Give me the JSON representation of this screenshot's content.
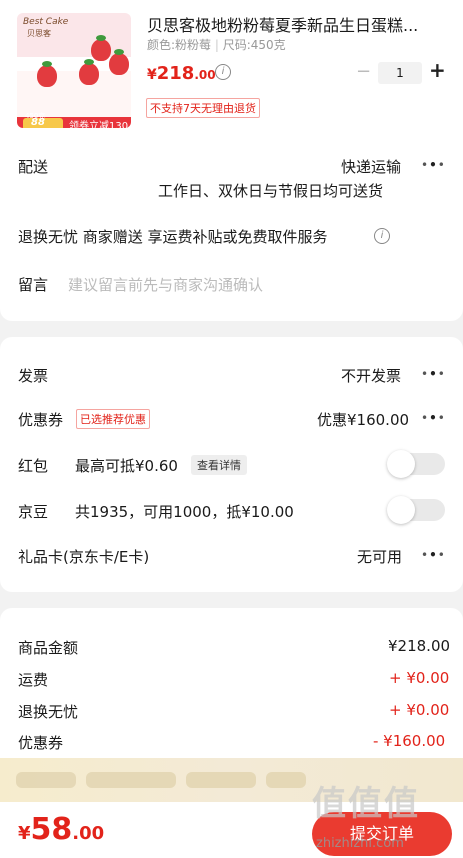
{
  "product": {
    "thumb_logo_line1": "Best Cake",
    "thumb_logo_line2": "贝思客",
    "thumb_size": "450克",
    "thumb_coin": "88",
    "thumb_band": "领券立减130",
    "title": "贝思客极地粉粉莓夏季新品生日蛋糕...",
    "color_label": "颜色:粉粉莓",
    "size_label": "尺码:450克",
    "price_currency": "¥",
    "price_int": "218",
    "price_dec": ".00",
    "quantity": "1",
    "qty_minus": "−",
    "qty_plus": "+",
    "return_policy": "不支持7天无理由退货"
  },
  "delivery": {
    "label": "配送",
    "method": "快递运输",
    "schedule": "工作日、双休日与节假日均可送货"
  },
  "service": {
    "text": "退换无忧 商家赠送 享运费补贴或免费取件服务"
  },
  "message": {
    "label": "留言",
    "placeholder": "建议留言前先与商家沟通确认"
  },
  "invoice": {
    "label": "发票",
    "value": "不开发票"
  },
  "coupon": {
    "label": "优惠券",
    "tag": "已选推荐优惠",
    "value": "优惠¥160.00"
  },
  "red_packet": {
    "label": "红包",
    "desc": "最高可抵¥0.60",
    "detail_btn": "查看详情",
    "enabled": false
  },
  "jingdou": {
    "label": "京豆",
    "desc": "共1935，可用1000，抵¥10.00",
    "enabled": false
  },
  "gift_card": {
    "label": "礼品卡(京东卡/E卡)",
    "value": "无可用"
  },
  "summary": {
    "rows": [
      {
        "label": "商品金额",
        "value": "¥218.00"
      },
      {
        "label": "运费",
        "value": "+ ¥0.00"
      },
      {
        "label": "退换无忧",
        "value": "+ ¥0.00"
      },
      {
        "label": "优惠券",
        "value": "- ¥160.00"
      }
    ]
  },
  "footer": {
    "total_currency": "¥",
    "total_int": "58",
    "total_dec": ".00",
    "submit_label": "提交订单",
    "watermark": "值值值",
    "watermark_url": "zhizhizhi.com"
  },
  "colors": {
    "accent": "#e2231a",
    "button": "#ea3b30"
  },
  "icons": [
    "info-icon",
    "more-dots-icon"
  ]
}
